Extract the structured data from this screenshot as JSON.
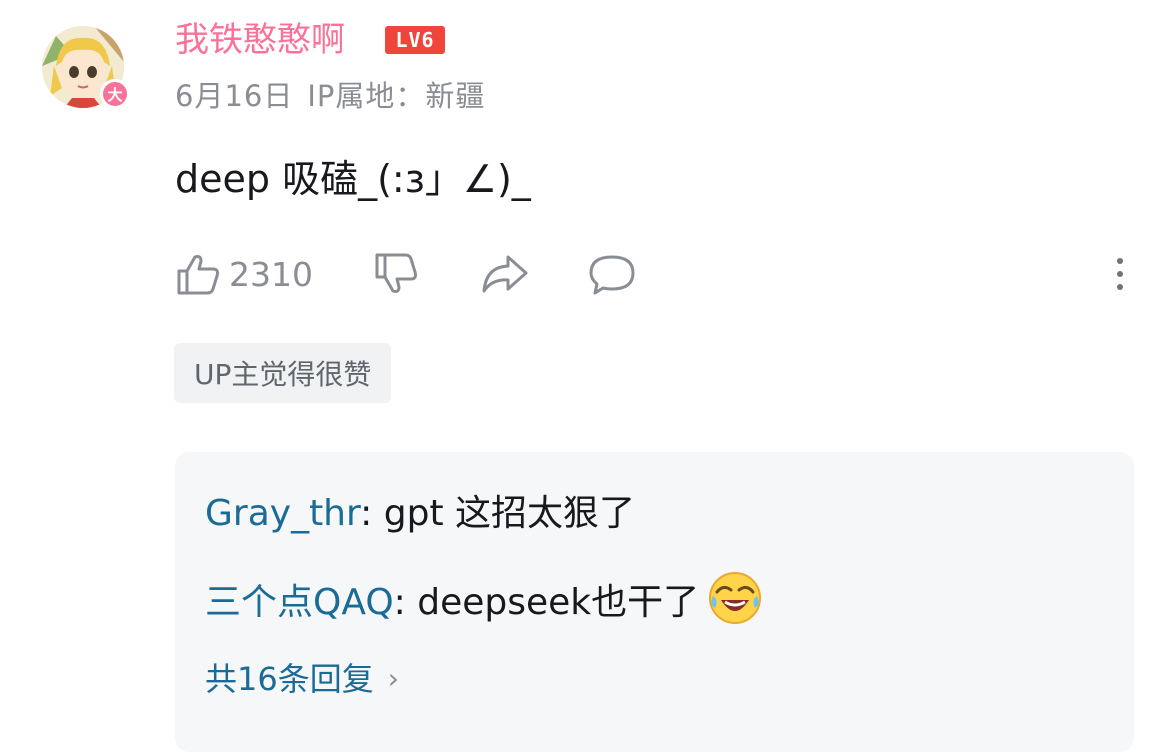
{
  "comment": {
    "username": "我铁憨憨啊",
    "level": "LV6",
    "vip_badge": "大",
    "date": "6月16日",
    "ip_location": "IP属地：新疆",
    "content": "deep 吸磕_(:з」∠)_",
    "like_count": "2310",
    "up_tag": "UP主觉得很赞"
  },
  "replies": [
    {
      "author": "Gray_thr",
      "separator": ": ",
      "text": "gpt 这招太狠了"
    },
    {
      "author": "三个点QAQ",
      "separator": ": ",
      "text": "deepseek也干了"
    }
  ],
  "more_replies": "共16条回复",
  "colors": {
    "username": "#fb7299",
    "level_badge": "#f0453a",
    "reply_author": "#1a6b97",
    "meta": "#8a8d93"
  },
  "icons": [
    "like-icon",
    "dislike-icon",
    "share-icon",
    "reply-icon",
    "more-icon",
    "chevron-right-icon",
    "laughing-emoji-icon"
  ]
}
